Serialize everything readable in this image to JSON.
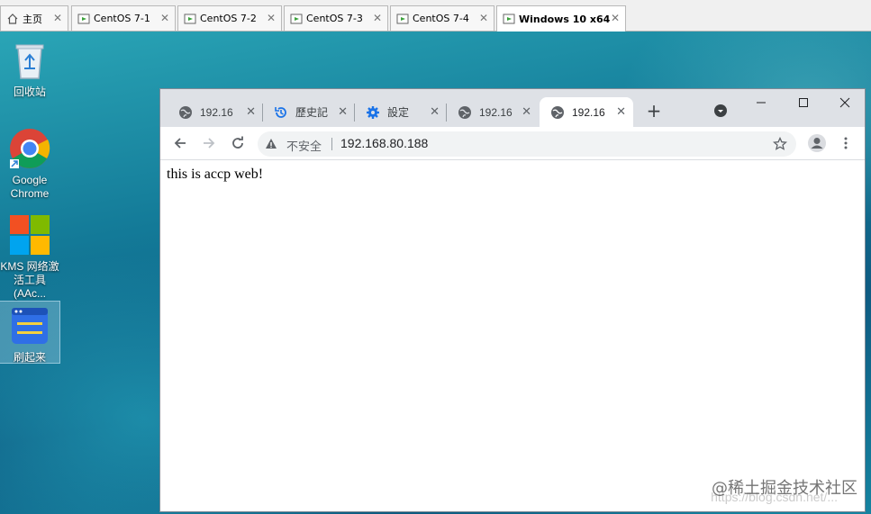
{
  "vm_tabs": [
    {
      "label": "主页",
      "icon": "home-icon"
    },
    {
      "label": "CentOS 7-1",
      "icon": "vm-icon"
    },
    {
      "label": "CentOS 7-2",
      "icon": "vm-icon"
    },
    {
      "label": "CentOS 7-3",
      "icon": "vm-icon"
    },
    {
      "label": "CentOS 7-4",
      "icon": "vm-icon"
    },
    {
      "label": "Windows 10 x64",
      "icon": "vm-icon",
      "active": true
    }
  ],
  "vm_tab_close": "✕",
  "desktop": {
    "icons": [
      {
        "label": "回收站",
        "icon": "recycle-bin-icon"
      },
      {
        "label": "Google Chrome",
        "icon": "chrome-icon"
      },
      {
        "label": "KMS 网络激活工具(AAc...",
        "icon": "windows-logo-icon"
      },
      {
        "label": "刷起来",
        "icon": "app-window-icon",
        "selected": true
      }
    ]
  },
  "browser": {
    "tabs": [
      {
        "label": "192.16",
        "icon": "globe-icon"
      },
      {
        "label": "歷史記",
        "icon": "history-icon"
      },
      {
        "label": "設定",
        "icon": "gear-icon"
      },
      {
        "label": "192.16",
        "icon": "globe-icon"
      },
      {
        "label": "192.16",
        "icon": "globe-icon",
        "active": true
      }
    ],
    "tab_close": "✕",
    "new_tab": "+",
    "omnibox": {
      "security_label": "不安全",
      "url": "192.168.80.188"
    },
    "page_text": "this is accp web!"
  },
  "watermark": {
    "text": "@稀土掘金技术社区",
    "url": "https://blog.csdn.net/..."
  },
  "colors": {
    "tabstrip": "#dee1e6",
    "omnibox": "#f1f3f4",
    "desktop": "#137a98"
  }
}
